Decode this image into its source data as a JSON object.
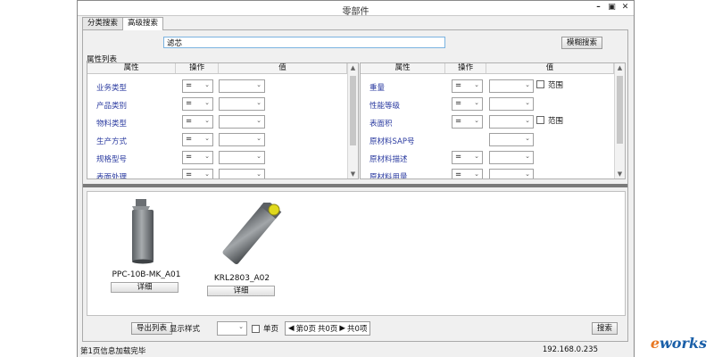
{
  "window": {
    "title": "零部件",
    "controls": [
      "minimize-icon",
      "maximize-icon",
      "close-icon"
    ]
  },
  "tabs": [
    {
      "label": "分类搜索",
      "active": false
    },
    {
      "label": "高级搜索",
      "active": true
    }
  ],
  "search": {
    "value": "滤芯",
    "fuzzy_button": "模糊搜索"
  },
  "attributes": {
    "legend": "属性列表",
    "columns": {
      "attr": "属性",
      "op": "操作",
      "value": "值"
    },
    "left_rows": [
      {
        "label": "业务类型",
        "op": "="
      },
      {
        "label": "产品类别",
        "op": "="
      },
      {
        "label": "物料类型",
        "op": "="
      },
      {
        "label": "生产方式",
        "op": "="
      },
      {
        "label": "规格型号",
        "op": "="
      },
      {
        "label": "表面处理",
        "op": "="
      }
    ],
    "right_rows": [
      {
        "label": "重量",
        "op": "=",
        "range": "范围"
      },
      {
        "label": "性能等级",
        "op": "="
      },
      {
        "label": "表面积",
        "op": "=",
        "range": "范围"
      },
      {
        "label": "原材料SAP号",
        "op": "="
      },
      {
        "label": "原材料描述",
        "op": "="
      },
      {
        "label": "原材料用量",
        "op": "="
      }
    ]
  },
  "results": [
    {
      "name": "PPC-10B-MK_A01",
      "detail": "详细"
    },
    {
      "name": "KRL2803_A02",
      "detail": "详细"
    }
  ],
  "bottom": {
    "export_button": "导出列表",
    "display_style_label": "显示样式",
    "single_page_label": "单页",
    "pager": {
      "text1": "第0页",
      "text2": "共0页",
      "text3": "共0项"
    },
    "search_button": "搜索"
  },
  "status": {
    "left": "第1页信息加载完毕",
    "right": "192.168.0.235"
  },
  "branding": {
    "prefix": "e",
    "rest": "works"
  }
}
